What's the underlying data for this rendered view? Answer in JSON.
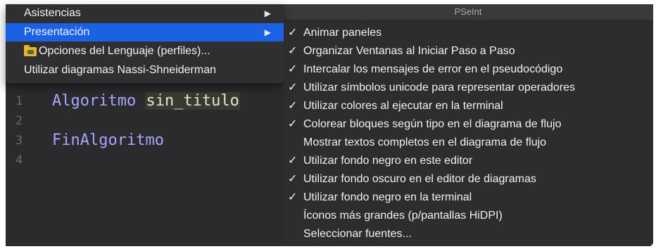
{
  "editor": {
    "lines": [
      {
        "number": "1",
        "keyword": "Algoritmo",
        "identifier": "sin_titulo"
      },
      {
        "number": "2",
        "keyword": "",
        "identifier": ""
      },
      {
        "number": "3",
        "keyword": "FinAlgoritmo",
        "identifier": ""
      },
      {
        "number": "4",
        "keyword": "",
        "identifier": ""
      }
    ]
  },
  "window": {
    "title": "PSeInt"
  },
  "menu": {
    "items": [
      {
        "label": "Asistencias",
        "has_submenu": true
      },
      {
        "label": "Presentación",
        "has_submenu": true,
        "selected": true
      },
      {
        "label": "Opciones del Lenguaje (perfiles)...",
        "icon": "folder-icon"
      },
      {
        "label": "Utilizar diagramas Nassi-Shneiderman"
      }
    ],
    "arrow_glyph": "▶"
  },
  "submenu": {
    "check_glyph": "✓",
    "items": [
      {
        "label": "Animar paneles",
        "checked": true
      },
      {
        "label": "Organizar Ventanas al Iniciar Paso a Paso",
        "checked": true
      },
      {
        "label": "Intercalar los mensajes de error en el pseudocódigo",
        "checked": true
      },
      {
        "label": "Utilizar símbolos unicode para representar operadores",
        "checked": true
      },
      {
        "label": "Utilizar colores al ejecutar en la terminal",
        "checked": true
      },
      {
        "label": "Colorear bloques según tipo en el diagrama de flujo",
        "checked": true
      },
      {
        "label": "Mostrar textos completos en el diagrama de flujo",
        "checked": false
      },
      {
        "label": "Utilizar fondo negro en este editor",
        "checked": true
      },
      {
        "label": "Utilizar fondo oscuro en el editor de diagramas",
        "checked": true
      },
      {
        "label": "Utilizar fondo negro en la terminal",
        "checked": true
      },
      {
        "label": "Íconos más grandes (p/pantallas HiDPI)",
        "checked": false
      },
      {
        "label": "Seleccionar fuentes...",
        "checked": false
      }
    ]
  },
  "colors": {
    "selection": "#1a61e3",
    "keyword": "#a8a5ff",
    "identifier": "#e9e4c8",
    "folder_icon": "#f0b22b"
  }
}
